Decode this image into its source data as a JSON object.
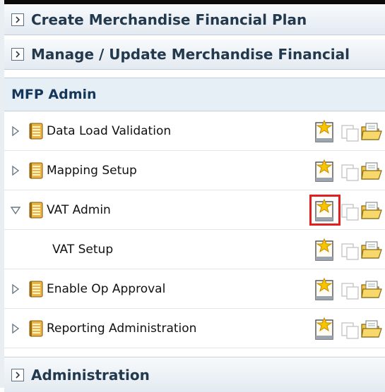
{
  "accordions": {
    "create_plan": "Create Merchandise Financial Plan",
    "manage_plan": "Manage / Update Merchandise Financial",
    "administration": "Administration"
  },
  "section": {
    "title": "MFP Admin"
  },
  "tree": {
    "rows": [
      {
        "label": "Data Load Validation",
        "state": "collapsed"
      },
      {
        "label": "Mapping Setup",
        "state": "collapsed"
      },
      {
        "label": "VAT Admin",
        "state": "expanded"
      },
      {
        "label": "VAT Setup",
        "state": "leaf"
      },
      {
        "label": "Enable Op Approval",
        "state": "collapsed"
      },
      {
        "label": "Reporting Administration",
        "state": "collapsed"
      }
    ]
  },
  "icons": {
    "accordion": "chevron-right-icon",
    "collapsed": "triangle-right-icon",
    "expanded": "triangle-down-icon",
    "folder": "notebook-icon",
    "create": "new-document-icon",
    "copy": "copy-icon",
    "open": "open-folder-icon"
  },
  "colors": {
    "highlight": "#e11f1f",
    "section_bg": "#e6eef6",
    "section_text": "#15385a"
  }
}
